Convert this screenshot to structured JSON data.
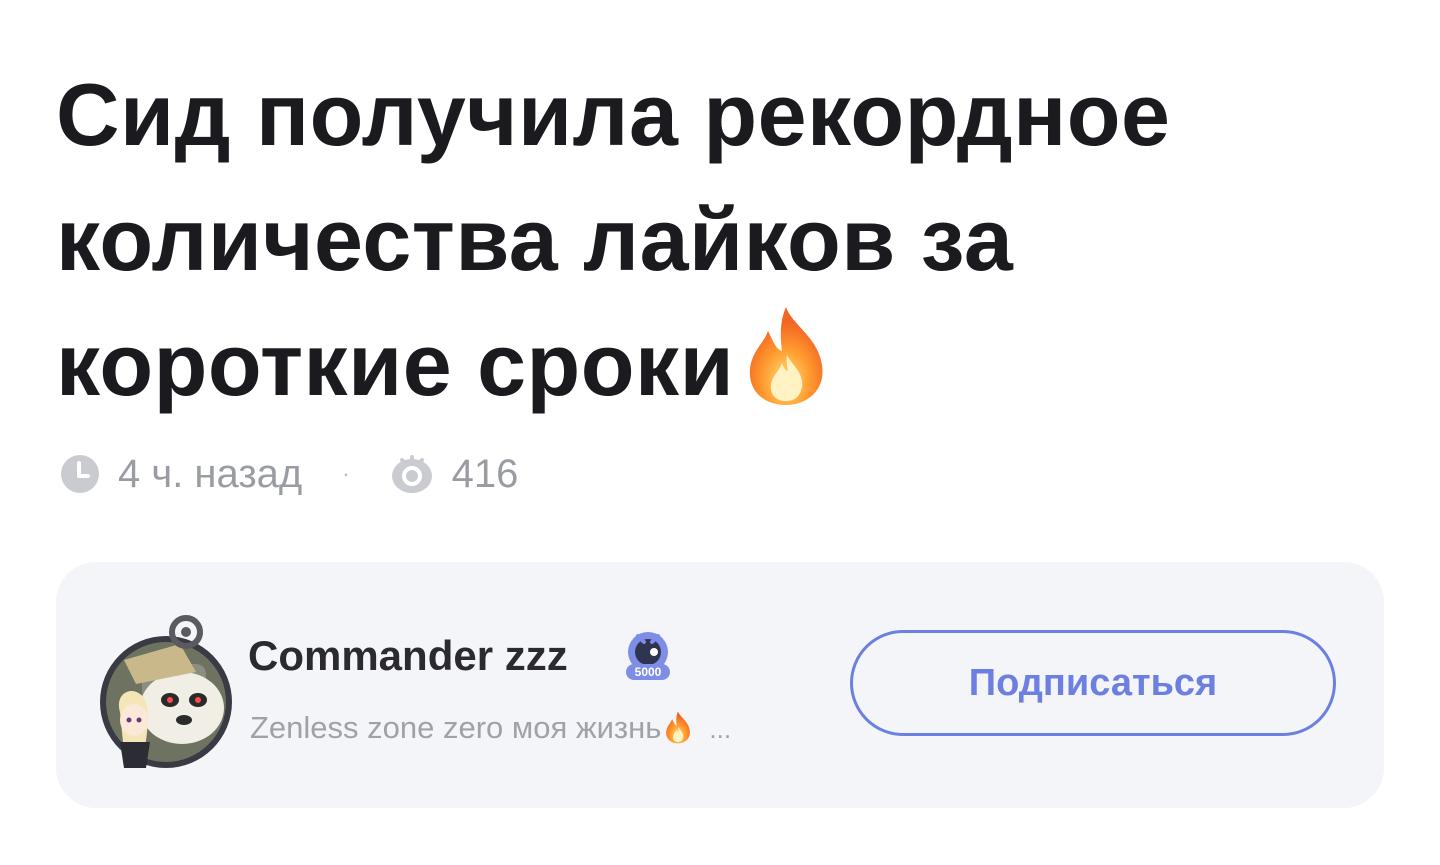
{
  "article": {
    "title": "Сид получила рекордное количества лайков за короткие сроки",
    "title_emoji": "fire-emoji"
  },
  "meta": {
    "time_icon": "clock-icon",
    "time_ago": "4 ч. назад",
    "separator": "·",
    "views_icon": "eye-icon",
    "views": "416"
  },
  "author": {
    "name": "Commander zzz",
    "badge_text": "5000",
    "bio": "Zenless zone zero моя жизнь",
    "bio_emoji": "fire-emoji",
    "bio_more": "...",
    "subscribe_label": "Подписаться"
  },
  "colors": {
    "title": "#1b1b1f",
    "meta": "#9a9ca3",
    "card_bg": "#f4f5f9",
    "accent": "#6d7fe0"
  }
}
